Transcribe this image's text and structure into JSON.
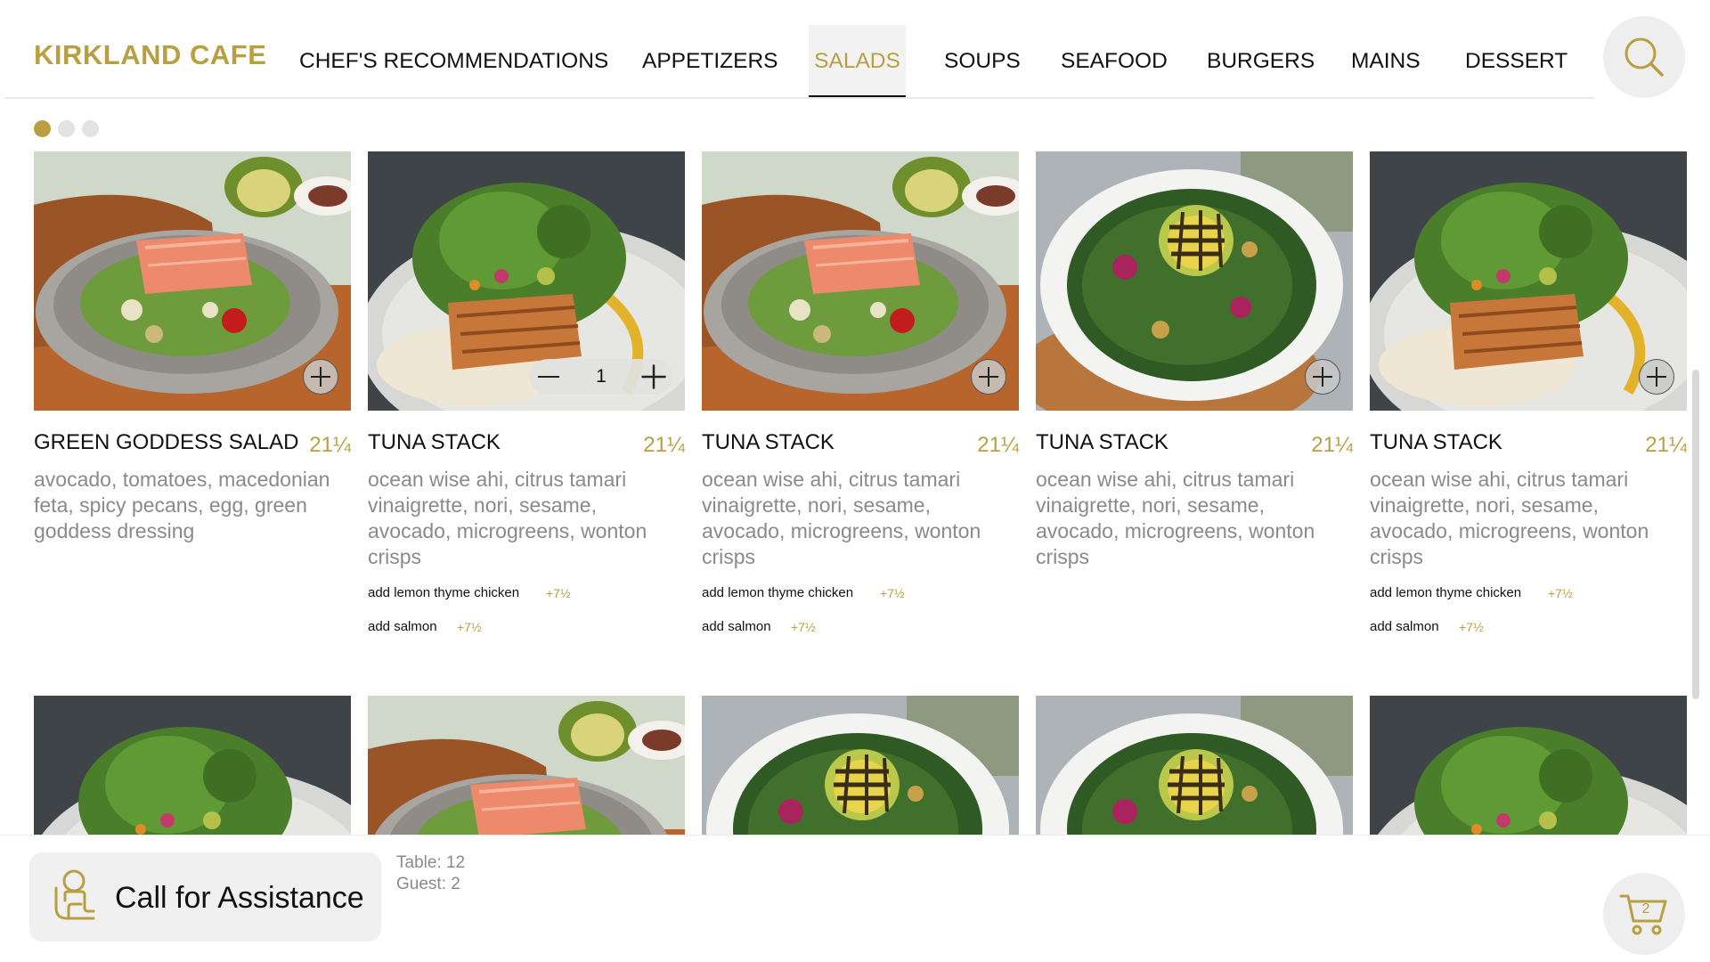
{
  "app": {
    "brand": "KIRKLAND CAFE",
    "accent_color": "#b8a042"
  },
  "nav": {
    "items": [
      {
        "label": "CHEF'S RECOMMENDATIONS",
        "active": false
      },
      {
        "label": "APPETIZERS",
        "active": false
      },
      {
        "label": "SALADS",
        "active": true
      },
      {
        "label": "SOUPS",
        "active": false
      },
      {
        "label": "SEAFOOD",
        "active": false
      },
      {
        "label": "BURGERS",
        "active": false
      },
      {
        "label": "MAINS",
        "active": false
      },
      {
        "label": "DESSERT",
        "active": false
      }
    ],
    "search_icon": "search-icon"
  },
  "carousel": {
    "pages": 3,
    "active_page": 1
  },
  "menu": {
    "items": [
      {
        "name": "GREEN GODDESS SALAD",
        "price": "21¼",
        "description": "avocado, tomatoes, macedonian feta, spicy pecans, egg, green goddess dressing",
        "image": "salmon-salad",
        "quantity": null,
        "addons": []
      },
      {
        "name": "TUNA STACK",
        "price": "21¼",
        "description": "ocean wise ahi, citrus tamari vinaigrette, nori, sesame, avocado, microgreens, wonton crisps",
        "image": "chicken-salad",
        "quantity": "1",
        "addons": [
          {
            "label": "add lemon thyme chicken",
            "price": "+7½"
          },
          {
            "label": "add salmon",
            "price": "+7½"
          }
        ]
      },
      {
        "name": "TUNA STACK",
        "price": "21¼",
        "description": "ocean wise ahi, citrus tamari vinaigrette, nori, sesame, avocado, microgreens, wonton crisps",
        "image": "salmon-salad",
        "quantity": null,
        "addons": [
          {
            "label": "add lemon thyme chicken",
            "price": "+7½"
          },
          {
            "label": "add salmon",
            "price": "+7½"
          }
        ]
      },
      {
        "name": "TUNA STACK",
        "price": "21¼",
        "description": "ocean wise ahi, citrus tamari vinaigrette, nori, sesame, avocado, microgreens, wonton crisps",
        "image": "kale-avocado-salad",
        "quantity": null,
        "addons": []
      },
      {
        "name": "TUNA STACK",
        "price": "21¼",
        "description": "ocean wise ahi, citrus tamari vinaigrette, nori, sesame, avocado, microgreens, wonton crisps",
        "image": "chicken-salad",
        "quantity": null,
        "addons": [
          {
            "label": "add lemon thyme chicken",
            "price": "+7½"
          },
          {
            "label": "add salmon",
            "price": "+7½"
          }
        ]
      }
    ],
    "second_row_images": [
      "chicken-salad",
      "salmon-salad",
      "kale-avocado-salad",
      "kale-avocado-salad",
      "chicken-salad"
    ]
  },
  "footer": {
    "assist_label": "Call for Assistance",
    "assist_icon": "person-assist-icon",
    "table": "Table: 12",
    "guest": "Guest: 2",
    "cart_icon": "cart-icon",
    "cart_count": "2"
  }
}
